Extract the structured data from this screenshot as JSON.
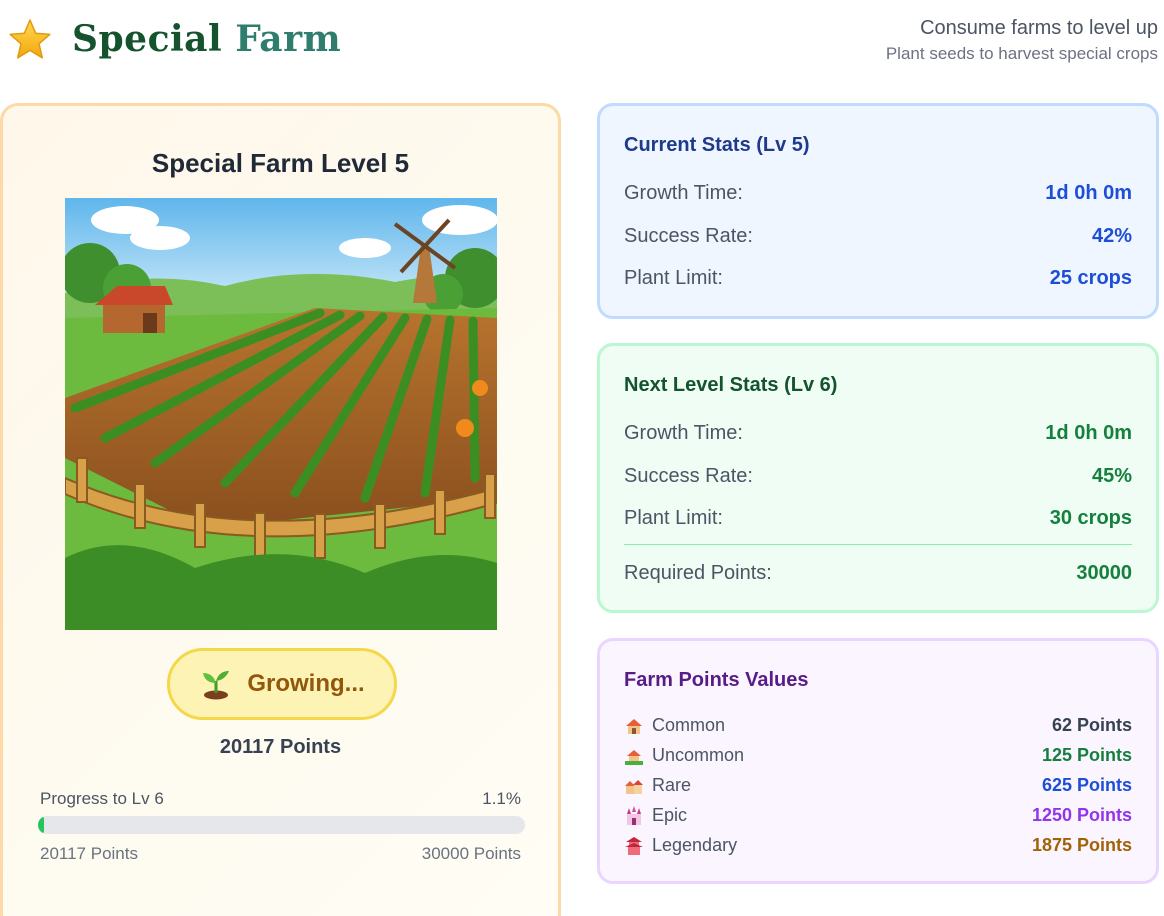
{
  "header": {
    "brand_word1": "Special",
    "brand_word2": "Farm",
    "tagline_main": "Consume farms to level up",
    "tagline_sub": "Plant seeds to harvest special crops",
    "logo_icon": "star-icon"
  },
  "farm": {
    "title": "Special Farm Level 5",
    "status_label": "Growing...",
    "status_icon": "sprout-icon",
    "points_text": "20117 Points",
    "progress": {
      "label": "Progress to Lv 6",
      "percent_text": "1.1%",
      "fraction": 0.011,
      "from_text": "20117 Points",
      "to_text": "30000 Points"
    }
  },
  "current_stats": {
    "title": "Current Stats (Lv 5)",
    "rows": [
      {
        "label": "Growth Time:",
        "value": "1d 0h 0m"
      },
      {
        "label": "Success Rate:",
        "value": "42%"
      },
      {
        "label": "Plant Limit:",
        "value": "25 crops"
      }
    ]
  },
  "next_stats": {
    "title": "Next Level Stats (Lv 6)",
    "rows": [
      {
        "label": "Growth Time:",
        "value": "1d 0h 0m"
      },
      {
        "label": "Success Rate:",
        "value": "45%"
      },
      {
        "label": "Plant Limit:",
        "value": "30 crops"
      }
    ],
    "required": {
      "label": "Required Points:",
      "value": "30000"
    }
  },
  "farm_points": {
    "title": "Farm Points Values",
    "rows": [
      {
        "name": "Common",
        "points": "62 Points",
        "color": "#374151",
        "icon": "house-icon"
      },
      {
        "name": "Uncommon",
        "points": "125 Points",
        "color": "#15803d",
        "icon": "house-garden-icon"
      },
      {
        "name": "Rare",
        "points": "625 Points",
        "color": "#1d4ed8",
        "icon": "houses-icon"
      },
      {
        "name": "Epic",
        "points": "1250 Points",
        "color": "#9333ea",
        "icon": "castle-icon"
      },
      {
        "name": "Legendary",
        "points": "1875 Points",
        "color": "#a16207",
        "icon": "pagoda-icon"
      }
    ]
  }
}
